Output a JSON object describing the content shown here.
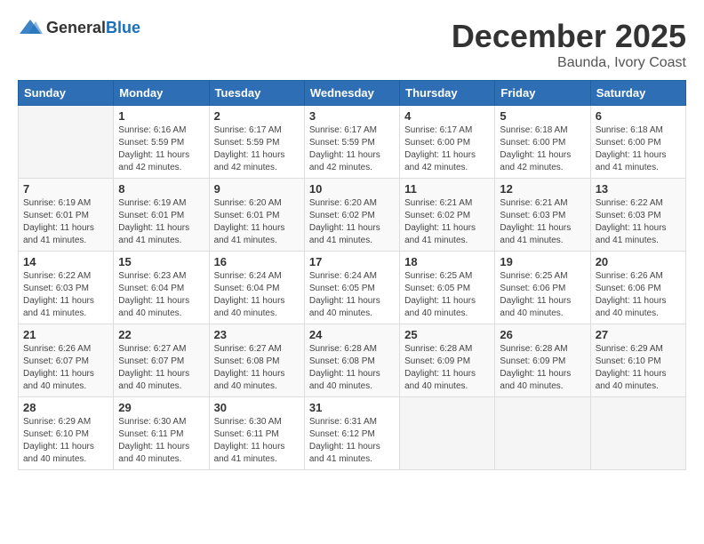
{
  "header": {
    "logo": {
      "general": "General",
      "blue": "Blue"
    },
    "month": "December 2025",
    "location": "Baunda, Ivory Coast"
  },
  "days_of_week": [
    "Sunday",
    "Monday",
    "Tuesday",
    "Wednesday",
    "Thursday",
    "Friday",
    "Saturday"
  ],
  "weeks": [
    [
      {
        "day": "",
        "sunrise": "",
        "sunset": "",
        "daylight": "",
        "empty": true
      },
      {
        "day": "1",
        "sunrise": "Sunrise: 6:16 AM",
        "sunset": "Sunset: 5:59 PM",
        "daylight": "Daylight: 11 hours and 42 minutes.",
        "empty": false
      },
      {
        "day": "2",
        "sunrise": "Sunrise: 6:17 AM",
        "sunset": "Sunset: 5:59 PM",
        "daylight": "Daylight: 11 hours and 42 minutes.",
        "empty": false
      },
      {
        "day": "3",
        "sunrise": "Sunrise: 6:17 AM",
        "sunset": "Sunset: 5:59 PM",
        "daylight": "Daylight: 11 hours and 42 minutes.",
        "empty": false
      },
      {
        "day": "4",
        "sunrise": "Sunrise: 6:17 AM",
        "sunset": "Sunset: 6:00 PM",
        "daylight": "Daylight: 11 hours and 42 minutes.",
        "empty": false
      },
      {
        "day": "5",
        "sunrise": "Sunrise: 6:18 AM",
        "sunset": "Sunset: 6:00 PM",
        "daylight": "Daylight: 11 hours and 42 minutes.",
        "empty": false
      },
      {
        "day": "6",
        "sunrise": "Sunrise: 6:18 AM",
        "sunset": "Sunset: 6:00 PM",
        "daylight": "Daylight: 11 hours and 41 minutes.",
        "empty": false
      }
    ],
    [
      {
        "day": "7",
        "sunrise": "Sunrise: 6:19 AM",
        "sunset": "Sunset: 6:01 PM",
        "daylight": "Daylight: 11 hours and 41 minutes.",
        "empty": false
      },
      {
        "day": "8",
        "sunrise": "Sunrise: 6:19 AM",
        "sunset": "Sunset: 6:01 PM",
        "daylight": "Daylight: 11 hours and 41 minutes.",
        "empty": false
      },
      {
        "day": "9",
        "sunrise": "Sunrise: 6:20 AM",
        "sunset": "Sunset: 6:01 PM",
        "daylight": "Daylight: 11 hours and 41 minutes.",
        "empty": false
      },
      {
        "day": "10",
        "sunrise": "Sunrise: 6:20 AM",
        "sunset": "Sunset: 6:02 PM",
        "daylight": "Daylight: 11 hours and 41 minutes.",
        "empty": false
      },
      {
        "day": "11",
        "sunrise": "Sunrise: 6:21 AM",
        "sunset": "Sunset: 6:02 PM",
        "daylight": "Daylight: 11 hours and 41 minutes.",
        "empty": false
      },
      {
        "day": "12",
        "sunrise": "Sunrise: 6:21 AM",
        "sunset": "Sunset: 6:03 PM",
        "daylight": "Daylight: 11 hours and 41 minutes.",
        "empty": false
      },
      {
        "day": "13",
        "sunrise": "Sunrise: 6:22 AM",
        "sunset": "Sunset: 6:03 PM",
        "daylight": "Daylight: 11 hours and 41 minutes.",
        "empty": false
      }
    ],
    [
      {
        "day": "14",
        "sunrise": "Sunrise: 6:22 AM",
        "sunset": "Sunset: 6:03 PM",
        "daylight": "Daylight: 11 hours and 41 minutes.",
        "empty": false
      },
      {
        "day": "15",
        "sunrise": "Sunrise: 6:23 AM",
        "sunset": "Sunset: 6:04 PM",
        "daylight": "Daylight: 11 hours and 40 minutes.",
        "empty": false
      },
      {
        "day": "16",
        "sunrise": "Sunrise: 6:24 AM",
        "sunset": "Sunset: 6:04 PM",
        "daylight": "Daylight: 11 hours and 40 minutes.",
        "empty": false
      },
      {
        "day": "17",
        "sunrise": "Sunrise: 6:24 AM",
        "sunset": "Sunset: 6:05 PM",
        "daylight": "Daylight: 11 hours and 40 minutes.",
        "empty": false
      },
      {
        "day": "18",
        "sunrise": "Sunrise: 6:25 AM",
        "sunset": "Sunset: 6:05 PM",
        "daylight": "Daylight: 11 hours and 40 minutes.",
        "empty": false
      },
      {
        "day": "19",
        "sunrise": "Sunrise: 6:25 AM",
        "sunset": "Sunset: 6:06 PM",
        "daylight": "Daylight: 11 hours and 40 minutes.",
        "empty": false
      },
      {
        "day": "20",
        "sunrise": "Sunrise: 6:26 AM",
        "sunset": "Sunset: 6:06 PM",
        "daylight": "Daylight: 11 hours and 40 minutes.",
        "empty": false
      }
    ],
    [
      {
        "day": "21",
        "sunrise": "Sunrise: 6:26 AM",
        "sunset": "Sunset: 6:07 PM",
        "daylight": "Daylight: 11 hours and 40 minutes.",
        "empty": false
      },
      {
        "day": "22",
        "sunrise": "Sunrise: 6:27 AM",
        "sunset": "Sunset: 6:07 PM",
        "daylight": "Daylight: 11 hours and 40 minutes.",
        "empty": false
      },
      {
        "day": "23",
        "sunrise": "Sunrise: 6:27 AM",
        "sunset": "Sunset: 6:08 PM",
        "daylight": "Daylight: 11 hours and 40 minutes.",
        "empty": false
      },
      {
        "day": "24",
        "sunrise": "Sunrise: 6:28 AM",
        "sunset": "Sunset: 6:08 PM",
        "daylight": "Daylight: 11 hours and 40 minutes.",
        "empty": false
      },
      {
        "day": "25",
        "sunrise": "Sunrise: 6:28 AM",
        "sunset": "Sunset: 6:09 PM",
        "daylight": "Daylight: 11 hours and 40 minutes.",
        "empty": false
      },
      {
        "day": "26",
        "sunrise": "Sunrise: 6:28 AM",
        "sunset": "Sunset: 6:09 PM",
        "daylight": "Daylight: 11 hours and 40 minutes.",
        "empty": false
      },
      {
        "day": "27",
        "sunrise": "Sunrise: 6:29 AM",
        "sunset": "Sunset: 6:10 PM",
        "daylight": "Daylight: 11 hours and 40 minutes.",
        "empty": false
      }
    ],
    [
      {
        "day": "28",
        "sunrise": "Sunrise: 6:29 AM",
        "sunset": "Sunset: 6:10 PM",
        "daylight": "Daylight: 11 hours and 40 minutes.",
        "empty": false
      },
      {
        "day": "29",
        "sunrise": "Sunrise: 6:30 AM",
        "sunset": "Sunset: 6:11 PM",
        "daylight": "Daylight: 11 hours and 40 minutes.",
        "empty": false
      },
      {
        "day": "30",
        "sunrise": "Sunrise: 6:30 AM",
        "sunset": "Sunset: 6:11 PM",
        "daylight": "Daylight: 11 hours and 41 minutes.",
        "empty": false
      },
      {
        "day": "31",
        "sunrise": "Sunrise: 6:31 AM",
        "sunset": "Sunset: 6:12 PM",
        "daylight": "Daylight: 11 hours and 41 minutes.",
        "empty": false
      },
      {
        "day": "",
        "sunrise": "",
        "sunset": "",
        "daylight": "",
        "empty": true
      },
      {
        "day": "",
        "sunrise": "",
        "sunset": "",
        "daylight": "",
        "empty": true
      },
      {
        "day": "",
        "sunrise": "",
        "sunset": "",
        "daylight": "",
        "empty": true
      }
    ]
  ]
}
